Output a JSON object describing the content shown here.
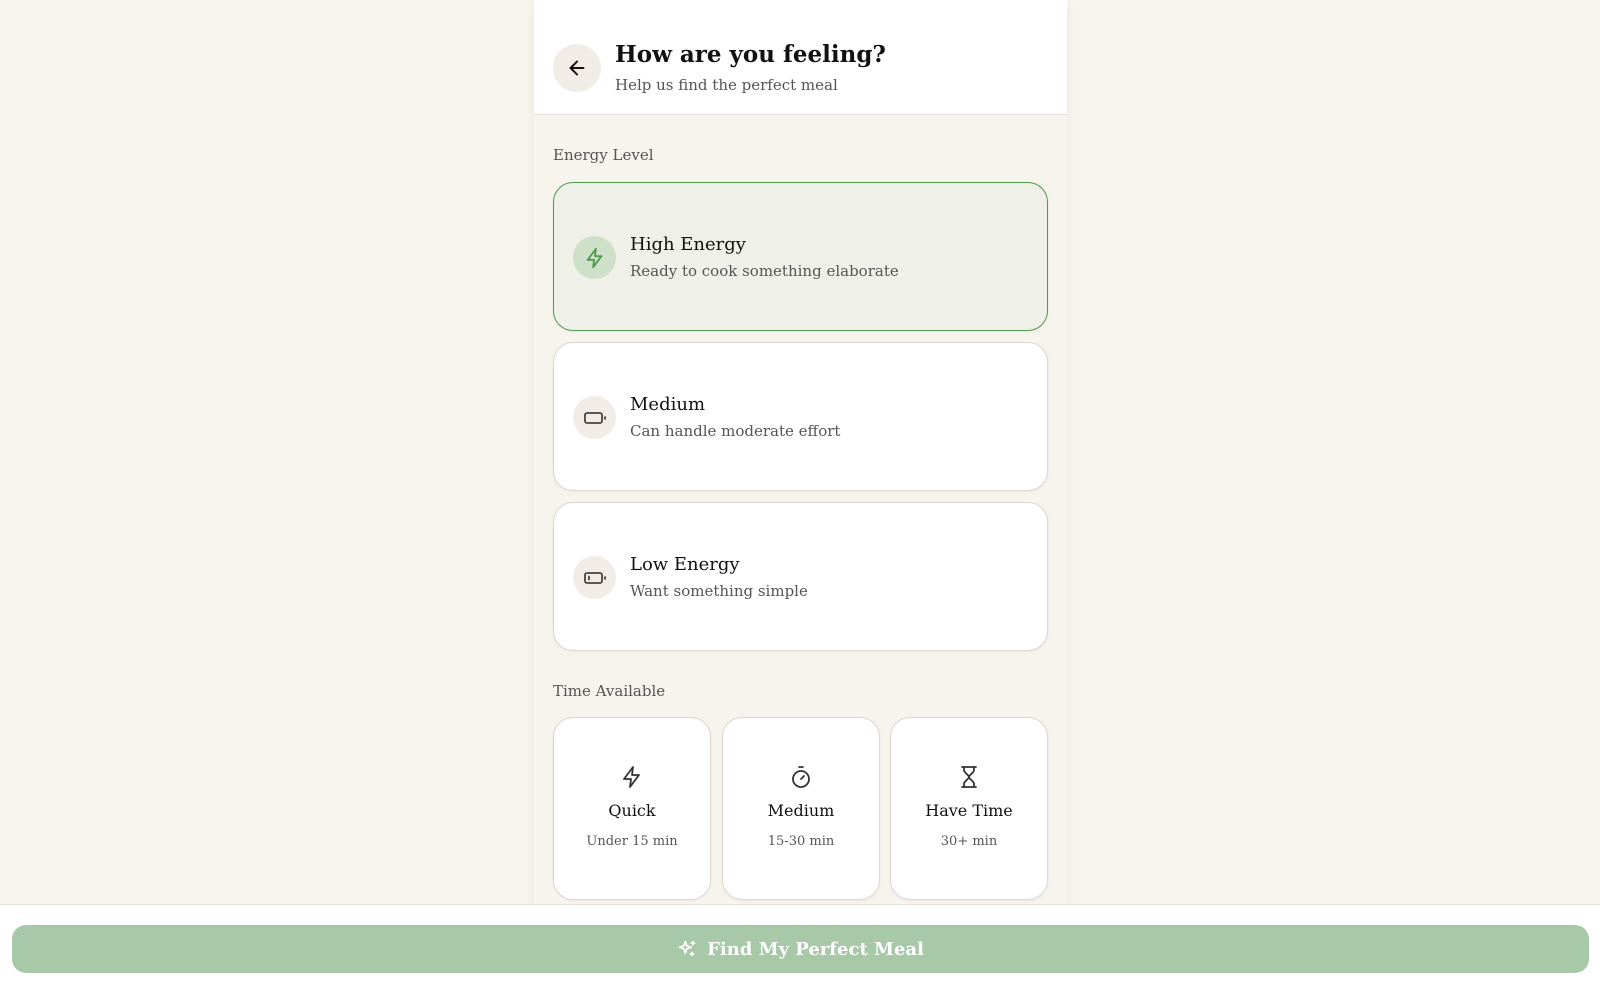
{
  "header": {
    "title": "How are you feeling?",
    "subtitle": "Help us find the perfect meal",
    "back_icon": "arrow-left-icon"
  },
  "energy": {
    "label": "Energy Level",
    "selected": "high",
    "options": [
      {
        "id": "high",
        "title": "High Energy",
        "desc": "Ready to cook something elaborate",
        "icon": "lightning-icon"
      },
      {
        "id": "medium",
        "title": "Medium",
        "desc": "Can handle moderate effort",
        "icon": "battery-medium-icon"
      },
      {
        "id": "low",
        "title": "Low Energy",
        "desc": "Want something simple",
        "icon": "battery-low-icon"
      }
    ]
  },
  "time": {
    "label": "Time Available",
    "options": [
      {
        "title": "Quick",
        "desc": "Under 15 min",
        "icon": "lightning-icon"
      },
      {
        "title": "Medium",
        "desc": "15-30 min",
        "icon": "stopwatch-icon"
      },
      {
        "title": "Have Time",
        "desc": "30+ min",
        "icon": "hourglass-icon"
      }
    ]
  },
  "cta": {
    "label": "Find My Perfect Meal",
    "icon": "sparkles-icon"
  },
  "colors": {
    "accent": "#4f9a50",
    "selected_bg": "#eff0e7",
    "cta_bg": "#a7c9a7",
    "page_bg": "#f8f4ee"
  }
}
